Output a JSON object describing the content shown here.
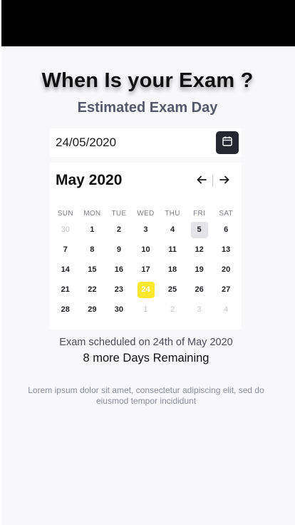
{
  "header": {
    "title": "When Is your Exam ?",
    "subtitle": "Estimated Exam Day"
  },
  "date_input": {
    "value": "24/05/2020"
  },
  "calendar": {
    "month_label": "May 2020",
    "prev_icon": "arrow-left-icon",
    "next_icon": "arrow-right-icon",
    "weekdays": [
      "SUN",
      "MON",
      "TUE",
      "WED",
      "THU",
      "FRI",
      "SAT"
    ],
    "weeks": [
      [
        {
          "d": "30",
          "muted": true
        },
        {
          "d": "1"
        },
        {
          "d": "2"
        },
        {
          "d": "3"
        },
        {
          "d": "4"
        },
        {
          "d": "5",
          "today": true
        },
        {
          "d": "6"
        }
      ],
      [
        {
          "d": "7"
        },
        {
          "d": "8"
        },
        {
          "d": "9"
        },
        {
          "d": "10"
        },
        {
          "d": "11"
        },
        {
          "d": "12"
        },
        {
          "d": "13"
        }
      ],
      [
        {
          "d": "14"
        },
        {
          "d": "15"
        },
        {
          "d": "16"
        },
        {
          "d": "17"
        },
        {
          "d": "18"
        },
        {
          "d": "19"
        },
        {
          "d": "20"
        }
      ],
      [
        {
          "d": "21"
        },
        {
          "d": "22"
        },
        {
          "d": "23"
        },
        {
          "d": "24",
          "selected": true
        },
        {
          "d": "25"
        },
        {
          "d": "26"
        },
        {
          "d": "27"
        }
      ],
      [
        {
          "d": "28"
        },
        {
          "d": "29"
        },
        {
          "d": "30"
        },
        {
          "d": "1",
          "muted": true
        },
        {
          "d": "2",
          "muted": true
        },
        {
          "d": "3",
          "muted": true
        },
        {
          "d": "4",
          "muted": true
        }
      ]
    ],
    "colors": {
      "selected": "#fce82e",
      "today": "#e4e4e8",
      "button": "#25262f"
    }
  },
  "summary": {
    "scheduled_text": "Exam scheduled on 24th of May 2020",
    "remaining_text": "8 more Days Remaining"
  },
  "footer": {
    "description": "Lorem ipsum dolor sit amet, consectetur adipiscing elit, sed do eiusmod tempor incididunt"
  }
}
